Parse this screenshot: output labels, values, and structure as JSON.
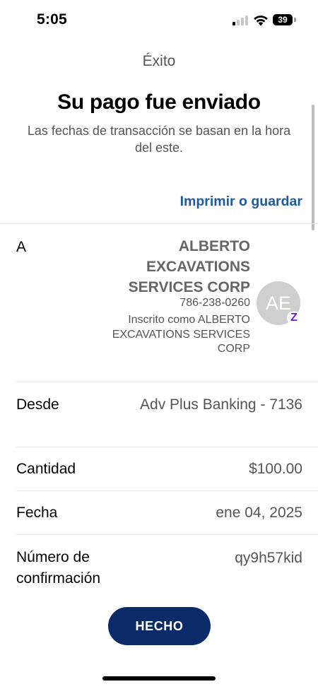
{
  "status_bar": {
    "time": "5:05",
    "battery_level": "39",
    "signal_bars_active": 1,
    "signal_bars_total": 4
  },
  "header": {
    "nav_title": "Éxito",
    "headline": "Su pago fue enviado",
    "subtitle": "Las fechas de transacción se basan en la hora del este.",
    "print_link": "Imprimir o guardar"
  },
  "details": {
    "recipient": {
      "label": "A",
      "name": "ALBERTO EXCAVATIONS SERVICES CORP",
      "phone": "786-238-0260",
      "enrolled_as": "Inscrito como ALBERTO EXCAVATIONS SERVICES CORP",
      "avatar_initials": "AE",
      "badge_icon": "zelle-icon",
      "badge_glyph": "Z"
    },
    "from": {
      "label": "Desde",
      "value": "Adv Plus Banking - 7136"
    },
    "amount": {
      "label": "Cantidad",
      "value": "$100.00"
    },
    "date": {
      "label": "Fecha",
      "value": "ene 04, 2025"
    },
    "confirmation": {
      "label": "Número de confirmación",
      "value": "qy9h57kid"
    }
  },
  "actions": {
    "done_label": "HECHO"
  },
  "colors": {
    "link": "#1a5aa6",
    "button": "#0b2a69",
    "zelle": "#6d1ed4"
  }
}
